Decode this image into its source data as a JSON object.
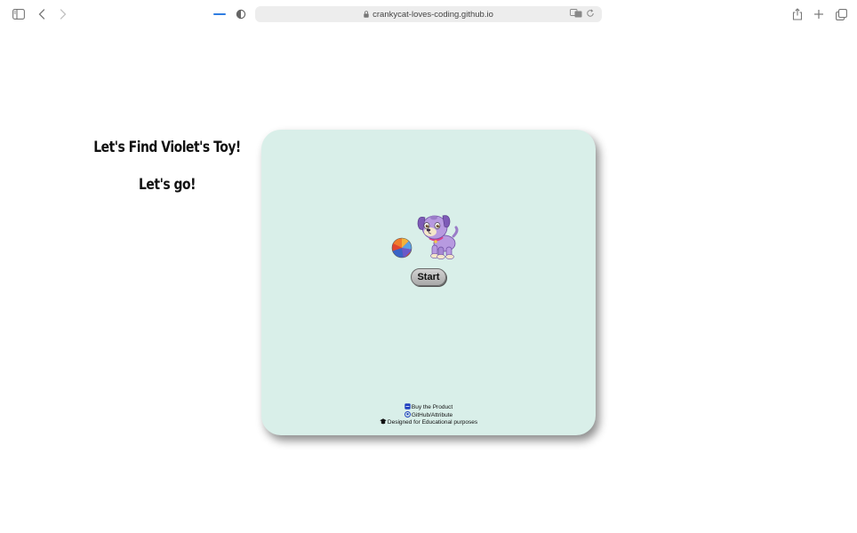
{
  "browser": {
    "url": "crankycat-loves-coding.github.io",
    "icons": {
      "sidebar": "sidebar-icon",
      "back": "chevron-left-icon",
      "forward": "chevron-right-icon",
      "privacy": "shield-half-icon",
      "lock": "lock-icon",
      "translate": "translate-icon",
      "reload": "reload-icon",
      "share": "share-icon",
      "new_tab": "plus-icon",
      "tab_overview": "tabs-icon"
    },
    "accent": "#2f7de1"
  },
  "game": {
    "title": "Let's Find Violet's Toy!",
    "status": "Let's go!",
    "start_label": "Start",
    "card_color": "#d9efe9"
  },
  "footer": {
    "buy_label": "Buy the Product",
    "github_label": "GitHub/Attribute",
    "designed_label": "Designed for Educational purposes"
  }
}
